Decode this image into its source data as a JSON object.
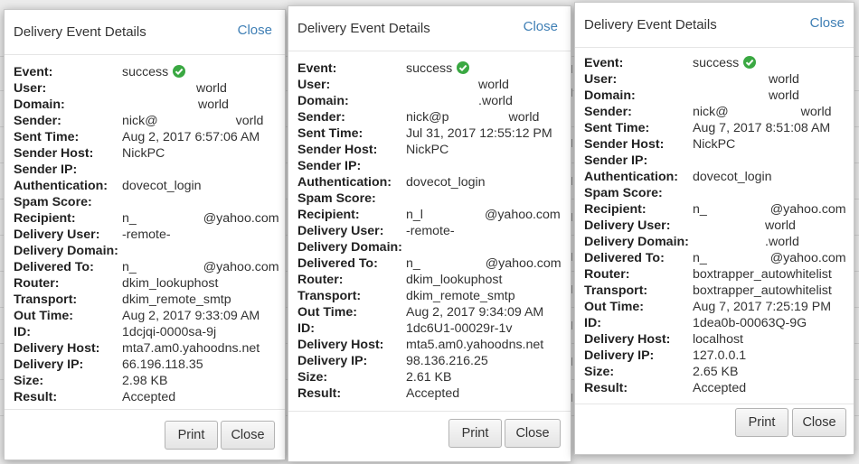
{
  "labels": {
    "event": "Event:",
    "user": "User:",
    "domain": "Domain:",
    "sender": "Sender:",
    "sent_time": "Sent Time:",
    "sender_host": "Sender Host:",
    "sender_ip": "Sender IP:",
    "authentication": "Authentication:",
    "spam_score": "Spam Score:",
    "recipient": "Recipient:",
    "delivery_user": "Delivery User:",
    "delivery_domain": "Delivery Domain:",
    "delivered_to": "Delivered To:",
    "router": "Router:",
    "transport": "Transport:",
    "out_time": "Out Time:",
    "id": "ID:",
    "delivery_host": "Delivery Host:",
    "delivery_ip": "Delivery IP:",
    "size": "Size:",
    "result": "Result:"
  },
  "dialogs": [
    {
      "title": "Delivery Event Details",
      "close_link": "Close",
      "print_button": "Print",
      "close_button": "Close",
      "status_icon": "check-circle-icon",
      "fields": {
        "event": "success",
        "user": "world",
        "domain": "world",
        "sender_prefix": "nick@",
        "sender_suffix": "vorld",
        "sent_time": "Aug 2, 2017 6:57:06 AM",
        "sender_host": "NickPC",
        "sender_ip": "",
        "authentication": "dovecot_login",
        "spam_score": "",
        "recipient_prefix": "n_",
        "recipient_suffix": "@yahoo.com",
        "delivery_user": "-remote-",
        "delivery_domain": "",
        "delivered_to_prefix": "n_",
        "delivered_to_suffix": "@yahoo.com",
        "router": "dkim_lookuphost",
        "transport": "dkim_remote_smtp",
        "out_time": "Aug 2, 2017 9:33:09 AM",
        "id": "1dcjqi-0000sa-9j",
        "delivery_host": "mta7.am0.yahoodns.net",
        "delivery_ip": "66.196.118.35",
        "size": "2.98 KB",
        "result": "Accepted"
      }
    },
    {
      "title": "Delivery Event Details",
      "close_link": "Close",
      "print_button": "Print",
      "close_button": "Close",
      "status_icon": "check-circle-icon",
      "fields": {
        "event": "success",
        "user": "world",
        "domain": ".world",
        "sender_prefix": "nick@p",
        "sender_suffix": "world",
        "sent_time": "Jul 31, 2017 12:55:12 PM",
        "sender_host": "NickPC",
        "sender_ip": "",
        "authentication": "dovecot_login",
        "spam_score": "",
        "recipient_prefix": "n_l",
        "recipient_suffix": "@yahoo.com",
        "delivery_user": "-remote-",
        "delivery_domain": "",
        "delivered_to_prefix": "n_",
        "delivered_to_suffix": "@yahoo.com",
        "router": "dkim_lookuphost",
        "transport": "dkim_remote_smtp",
        "out_time": "Aug 2, 2017 9:34:09 AM",
        "id": "1dc6U1-00029r-1v",
        "delivery_host": "mta5.am0.yahoodns.net",
        "delivery_ip": "98.136.216.25",
        "size": "2.61 KB",
        "result": "Accepted"
      }
    },
    {
      "title": "Delivery Event Details",
      "close_link": "Close",
      "print_button": "Print",
      "close_button": "Close",
      "status_icon": "check-circle-icon",
      "fields": {
        "event": "success",
        "user": "world",
        "domain": "world",
        "sender_prefix": "nick@",
        "sender_suffix": "world",
        "sent_time": "Aug 7, 2017 8:51:08 AM",
        "sender_host": "NickPC",
        "sender_ip": "",
        "authentication": "dovecot_login",
        "spam_score": "",
        "recipient_prefix": "n_",
        "recipient_suffix": "@yahoo.com",
        "delivery_user": "world",
        "delivery_domain": ".world",
        "delivered_to_prefix": "n_",
        "delivered_to_suffix": "@yahoo.com",
        "router": "boxtrapper_autowhitelist",
        "transport": "boxtrapper_autowhitelist",
        "out_time": "Aug 7, 2017 7:25:19 PM",
        "id": "1dea0b-00063Q-9G",
        "delivery_host": "localhost",
        "delivery_ip": "127.0.0.1",
        "size": "2.65 KB",
        "result": "Accepted"
      }
    }
  ]
}
